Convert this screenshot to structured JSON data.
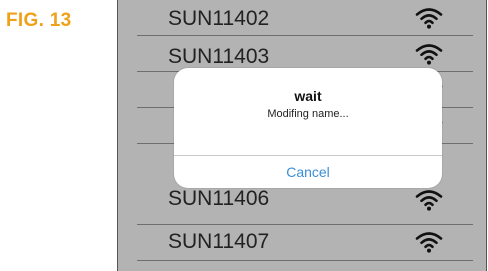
{
  "figure_label": "FIG. 13",
  "wifi_list": {
    "items": [
      {
        "name": "SUN11402",
        "icon": "wifi-icon"
      },
      {
        "name": "SUN11403",
        "icon": "wifi-icon"
      },
      {
        "name": "",
        "icon": "wifi-icon"
      },
      {
        "name": "",
        "icon": "wifi-icon"
      },
      {
        "name": "SUN11406",
        "icon": "wifi-icon"
      },
      {
        "name": "SUN11407",
        "icon": "wifi-icon"
      }
    ]
  },
  "dialog": {
    "title": "wait",
    "message": "Modifing name...",
    "cancel_label": "Cancel"
  },
  "colors": {
    "figure_label": "#f0a11a",
    "screen_background": "#b3b3b3",
    "cancel_text": "#3b8fd9"
  }
}
